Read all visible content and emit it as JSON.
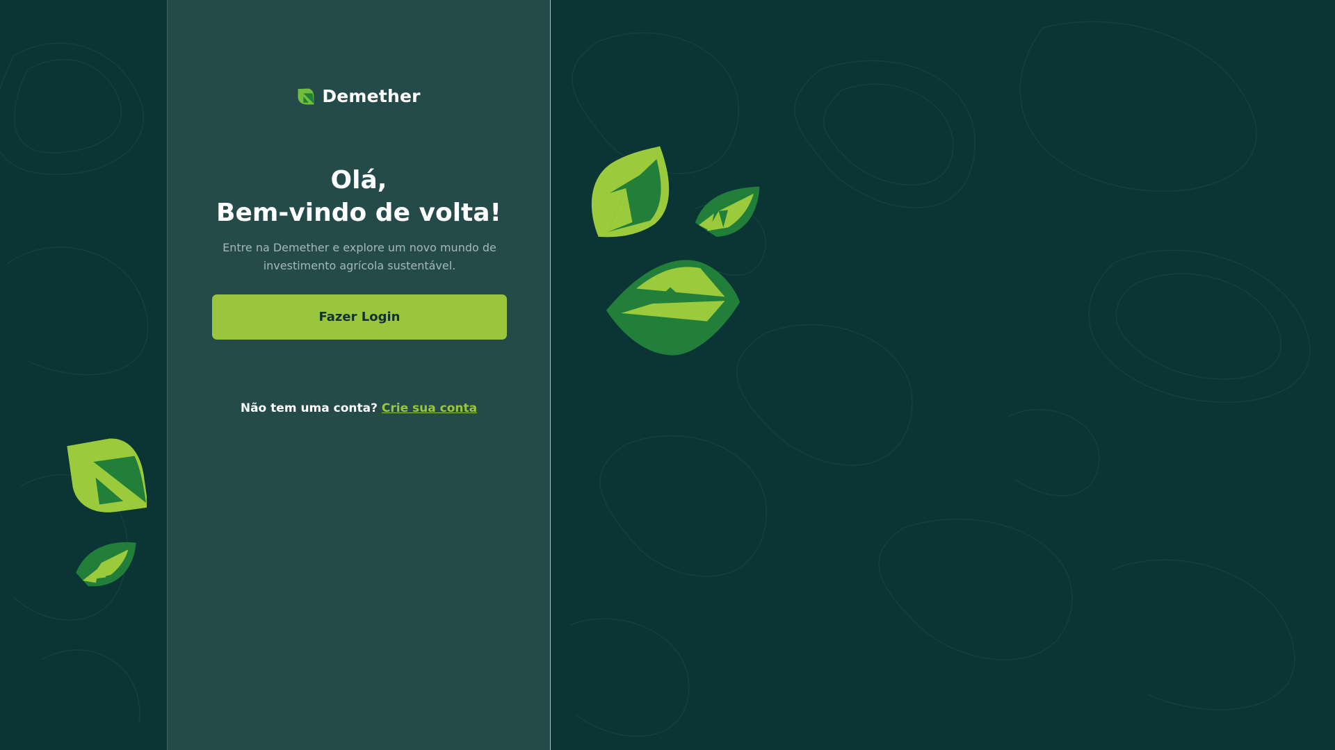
{
  "brand": {
    "name": "Demether",
    "logo_icon": "demether-leaf-logo-icon"
  },
  "greeting": {
    "line1": "Olá,",
    "line2": "Bem-vindo de volta!"
  },
  "subtitle": "Entre na Demether e explore um novo mundo de investimento agrícola sustentável.",
  "login_button": {
    "label": "Fazer Login"
  },
  "signup": {
    "prompt": "Não tem uma conta?",
    "link_label": "Crie sua conta"
  },
  "colors": {
    "background": "#0b3535",
    "panel": "#244b4a",
    "accent": "#99c63d",
    "leaf_dark": "#217f3a",
    "leaf_light": "#9bcb3d"
  },
  "decorations": [
    "leaf-icon",
    "leaf-icon",
    "leaf-icon",
    "leaf-icon",
    "leaf-icon"
  ]
}
